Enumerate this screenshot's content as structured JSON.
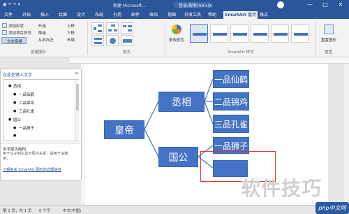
{
  "titlebar": {
    "doc_title": "新建 Microsoft...",
    "search_hint": "登录/搜索(Alt+Q)",
    "minimize": "—",
    "maximize": "□",
    "close": "✕"
  },
  "tabs": [
    {
      "label": "文件"
    },
    {
      "label": "开始"
    },
    {
      "label": "插入"
    },
    {
      "label": "绘图"
    },
    {
      "label": "设计"
    },
    {
      "label": "布局"
    },
    {
      "label": "引用"
    },
    {
      "label": "邮件"
    },
    {
      "label": "审阅"
    },
    {
      "label": "视图"
    },
    {
      "label": "开发工具"
    },
    {
      "label": "帮助"
    },
    {
      "label": "SmartArt 设计"
    },
    {
      "label": "格式"
    }
  ],
  "ribbon": {
    "add_shape": "添加形状",
    "add_bullet": "添加项目符号",
    "text_pane": "文本窗格",
    "promote": "升级",
    "demote": "降级",
    "move_up": "上移",
    "move_down": "下移",
    "right_to_left": "从右向左",
    "layout": "布局",
    "change_colors": "更改颜色",
    "reset_graphic": "重置图形",
    "create_graphic_group": "创建图形",
    "layouts_group": "版式",
    "styles_group": "SmartArt 样式",
    "reset_group": "重置"
  },
  "text_pane": {
    "title": "在此处键入文字",
    "close": "×",
    "items": [
      {
        "label": "丞相",
        "level": 1
      },
      {
        "label": "一品仙鹤",
        "level": 2
      },
      {
        "label": "二品锦鸡",
        "level": 2
      },
      {
        "label": "三品孔雀",
        "level": 2
      },
      {
        "label": "国公",
        "level": 1
      },
      {
        "label": "一品狮子",
        "level": 2
      },
      {
        "label": "",
        "level": 2
      }
    ],
    "description_title": "水平层次结构",
    "description": "用于从左到右显示层次关系，适用于决策树。",
    "link": "了解有关 SmartArt 图形的详细信息"
  },
  "smartart": {
    "root": "皇帝",
    "branch1": "丞相",
    "branch2": "国公",
    "leaf1": "一品仙鹤",
    "leaf2": "二品锦鸡",
    "leaf3": "三品孔雀",
    "leaf4": "一品狮子",
    "leaf5": ""
  },
  "status": {
    "page": "第 1 页，共 1 页",
    "words": "0 个字",
    "lang": "中文(中国)"
  },
  "watermark": "软件技巧",
  "logo": "php中文网",
  "colors": {
    "word_blue": "#2b579a",
    "smartart_fill": "#4472c4",
    "annotation_red": "#e03535"
  }
}
